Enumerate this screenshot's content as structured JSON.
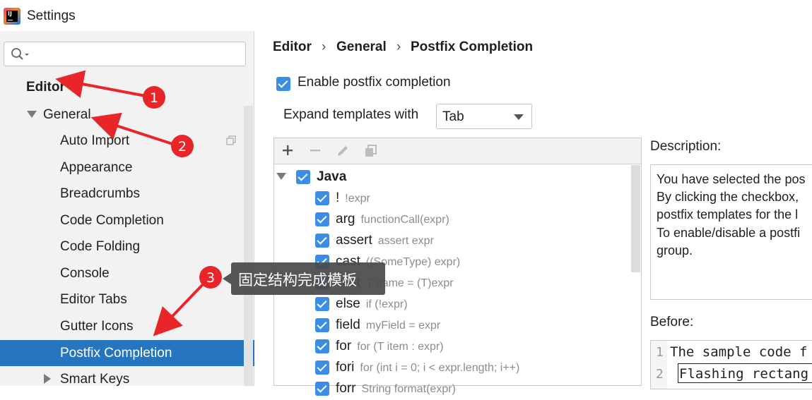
{
  "window": {
    "title": "Settings",
    "app_icon_text": "IJ"
  },
  "search": {
    "placeholder": "",
    "value": ""
  },
  "sidebar": {
    "editor": "Editor",
    "general": "General",
    "items": [
      "Auto Import",
      "Appearance",
      "Breadcrumbs",
      "Code Completion",
      "Code Folding",
      "Console",
      "Editor Tabs",
      "Gutter Icons"
    ],
    "selected": "Postfix Completion",
    "smart_keys": "Smart Keys"
  },
  "breadcrumb": {
    "items": [
      "Editor",
      "General",
      "Postfix Completion"
    ],
    "separator": "›"
  },
  "settings": {
    "enable_label": "Enable postfix completion",
    "enable_checked": true,
    "expand_label": "Expand templates with",
    "expand_value": "Tab"
  },
  "templates": {
    "group": "Java",
    "rows": [
      {
        "key": "!",
        "expr": "!expr"
      },
      {
        "key": "arg",
        "expr": "functionCall(expr)"
      },
      {
        "key": "assert",
        "expr": "assert expr"
      },
      {
        "key": "cast",
        "expr": "((SomeType) expr)"
      },
      {
        "key": "cast",
        "expr": "T name = (T)expr"
      },
      {
        "key": "else",
        "expr": "if (!expr)"
      },
      {
        "key": "field",
        "expr": "myField = expr"
      },
      {
        "key": "for",
        "expr": "for (T item : expr)"
      },
      {
        "key": "fori",
        "expr": "for (int i = 0; i < expr.length; i++)"
      },
      {
        "key": "forr",
        "expr": "String format(expr)"
      }
    ]
  },
  "description": {
    "label": "Description:",
    "lines": [
      "You have selected the pos",
      "By clicking the checkbox,",
      "postfix templates for the l",
      "To enable/disable a postfi",
      "group."
    ]
  },
  "before": {
    "label": "Before:",
    "line1_num": "1",
    "line1": "The sample code f",
    "line2_num": "2",
    "line2": "Flashing rectang"
  },
  "annotations": {
    "tooltip": "固定结构完成模板",
    "markers": [
      "1",
      "2",
      "3"
    ],
    "color": "#e8262a"
  }
}
